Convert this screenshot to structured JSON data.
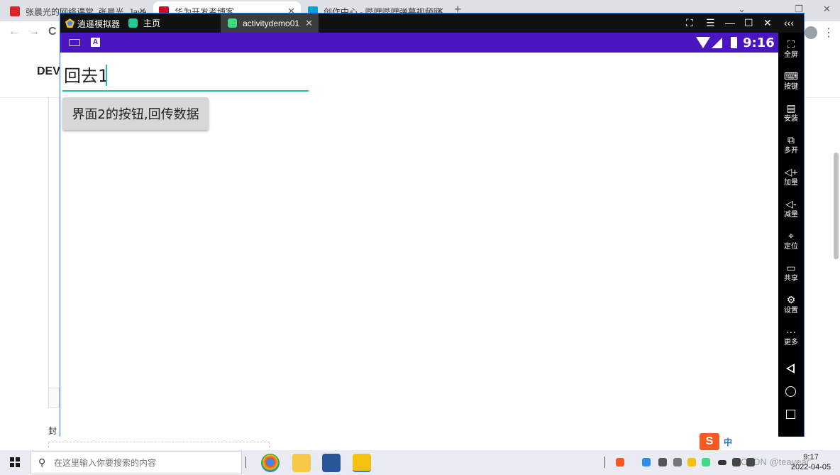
{
  "browser": {
    "tabs": [
      {
        "title": "张晨光的网络课堂_张晨光_Java",
        "favicon_color": "#d9232d"
      },
      {
        "title": "华为开发者博客",
        "favicon_color": "#cf0a2c"
      },
      {
        "title": "创作中心 - 哔哩哔哩弹幕视频网",
        "favicon_color": "#00a1d6"
      }
    ],
    "close_glyph": "✕",
    "new_tab_glyph": "+",
    "back_glyph": "←",
    "forward_glyph": "→",
    "reload_glyph": "C",
    "menu_glyph": "⋮",
    "page": {
      "header_text": "DEV",
      "bottom_text": "封"
    }
  },
  "emulator": {
    "app_name": "逍遥模拟器",
    "tabs": [
      {
        "label": "主页",
        "icon_color": "#20c997"
      },
      {
        "label": "activitydemo01",
        "icon_color": "#3ddc84"
      }
    ],
    "controls": [
      "⛶",
      "☰",
      "—",
      "☐",
      "✕",
      "‹‹‹"
    ],
    "android": {
      "status_time": "9:16",
      "status_a_label": "A",
      "edit_text_value": "回去1",
      "button_label": "界面2的按钮,回传数据"
    },
    "sidebar": [
      {
        "icon": "fullscreen-icon",
        "glyph": "⛶",
        "label": "全屏"
      },
      {
        "icon": "keyboard-icon",
        "glyph": "⌨",
        "label": "按键"
      },
      {
        "icon": "apk-install-icon",
        "glyph": "▤",
        "label": "安装"
      },
      {
        "icon": "multi-instance-icon",
        "glyph": "⧉",
        "label": "多开"
      },
      {
        "icon": "volume-up-icon",
        "glyph": "◁+",
        "label": "加量"
      },
      {
        "icon": "volume-down-icon",
        "glyph": "◁-",
        "label": "减量"
      },
      {
        "icon": "location-icon",
        "glyph": "⌖",
        "label": "定位"
      },
      {
        "icon": "folder-icon",
        "glyph": "▭",
        "label": "共享"
      },
      {
        "icon": "gear-icon",
        "glyph": "⚙",
        "label": "设置"
      },
      {
        "icon": "more-icon",
        "glyph": "···",
        "label": "更多"
      }
    ]
  },
  "taskbar": {
    "search_placeholder": "在这里输入你要搜索的内容",
    "search_glyph": "⚲",
    "tray_time": "9:17",
    "tray_date": "2022-04-05",
    "ime_badge": "S",
    "ime_text": "中",
    "watermark": "CSDN @teayear"
  }
}
